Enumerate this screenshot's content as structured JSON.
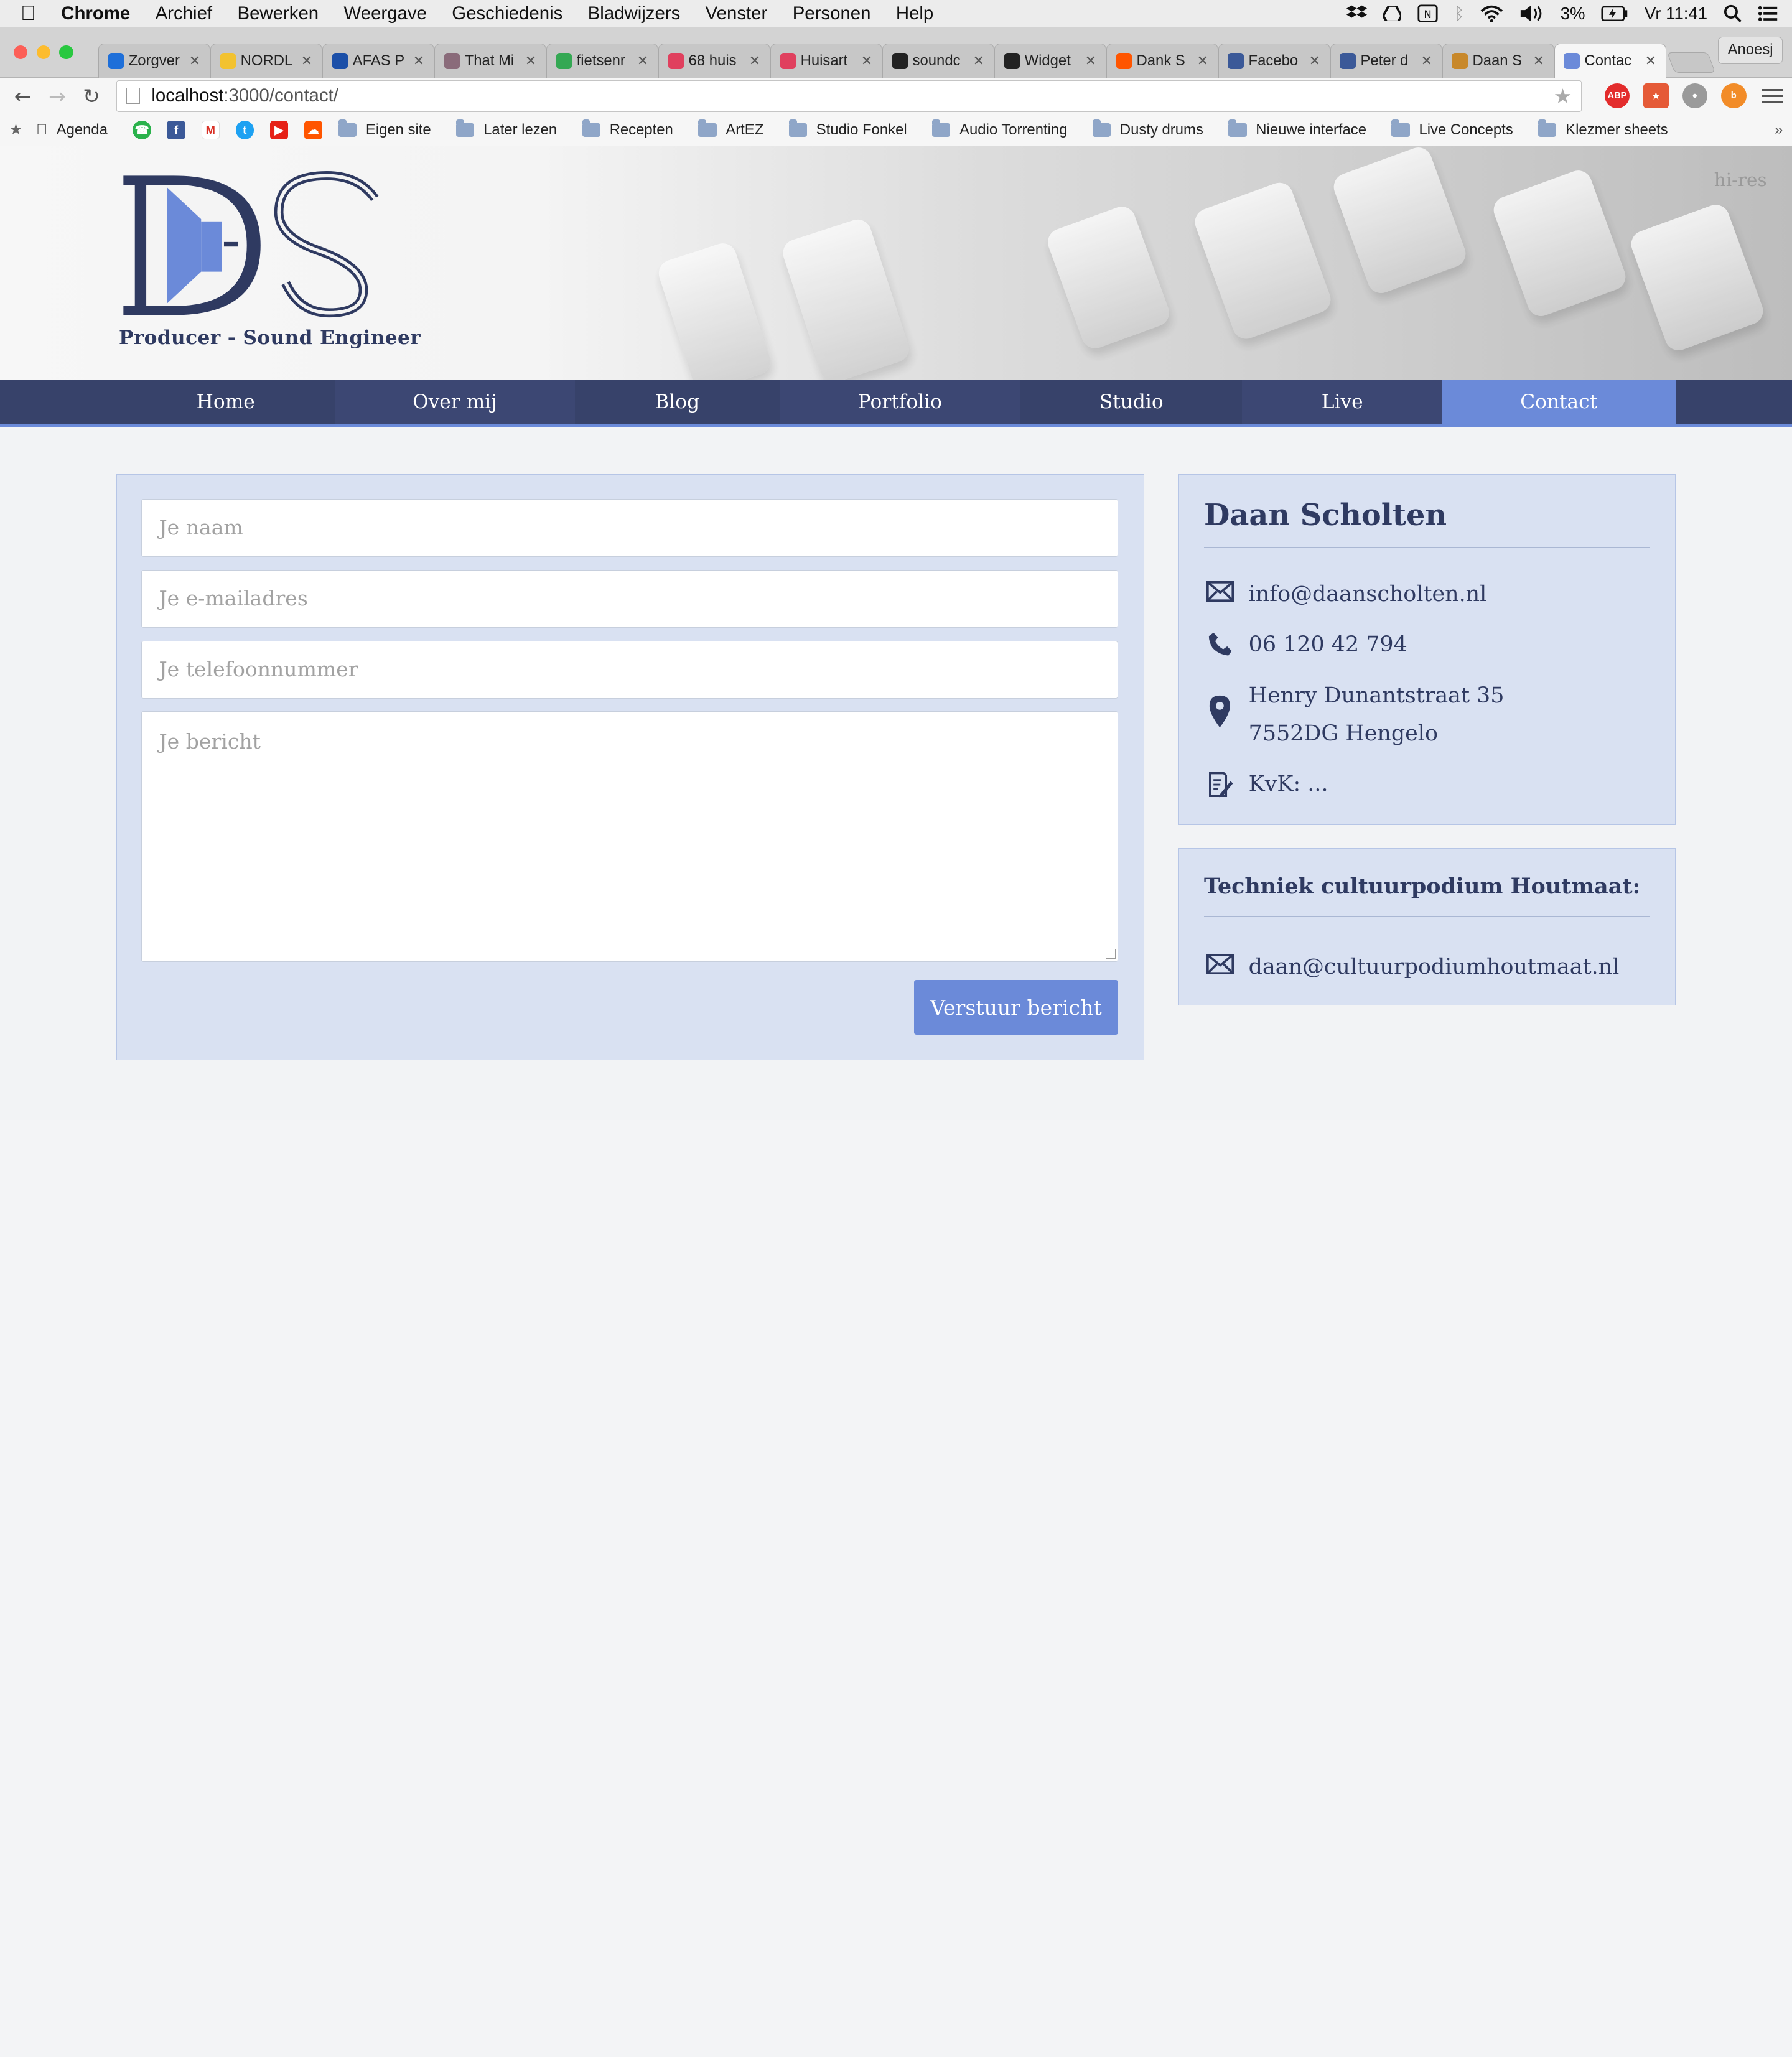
{
  "menubar": {
    "app": "Chrome",
    "items": [
      "Archief",
      "Bewerken",
      "Weergave",
      "Geschiedenis",
      "Bladwijzers",
      "Venster",
      "Personen",
      "Help"
    ],
    "battery": "3%",
    "clock": "Vr 11:41"
  },
  "tabs": [
    {
      "title": "Zorgver",
      "color": "#1e6fd9"
    },
    {
      "title": "NORDL",
      "color": "#f2c230"
    },
    {
      "title": "AFAS P",
      "color": "#1b4fa8"
    },
    {
      "title": "That Mi",
      "color": "#8a6b7a"
    },
    {
      "title": "fietsenr",
      "color": "#34a853"
    },
    {
      "title": "68 huis",
      "color": "#e0405e"
    },
    {
      "title": "Huisart",
      "color": "#e0405e"
    },
    {
      "title": "soundc",
      "color": "#222222"
    },
    {
      "title": "Widget",
      "color": "#222222"
    },
    {
      "title": "Dank S",
      "color": "#ff5500"
    },
    {
      "title": "Facebo",
      "color": "#3b5998"
    },
    {
      "title": "Peter d",
      "color": "#3b5998"
    },
    {
      "title": "Daan S",
      "color": "#c8882a"
    },
    {
      "title": "Contac",
      "color": "#6b8ad9"
    }
  ],
  "profile": "Anoesj",
  "address": {
    "host": "localhost",
    "path": ":3000/contact/"
  },
  "bookmarks": {
    "first": "Agenda",
    "folders": [
      "Eigen site",
      "Later lezen",
      "Recepten",
      "ArtEZ",
      "Studio Fonkel",
      "Audio Torrenting",
      "Dusty drums",
      "Nieuwe interface",
      "Live Concepts",
      "Klezmer sheets"
    ],
    "more": "»"
  },
  "site": {
    "tagline": "Producer - Sound Engineer",
    "hires": "hi-res",
    "nav": [
      "Home",
      "Over mij",
      "Blog",
      "Portfolio",
      "Studio",
      "Live",
      "Contact"
    ],
    "active_nav": "Contact"
  },
  "form": {
    "name_placeholder": "Je naam",
    "email_placeholder": "Je e-mailadres",
    "phone_placeholder": "Je telefoonnummer",
    "message_placeholder": "Je bericht",
    "submit": "Verstuur bericht"
  },
  "contact": {
    "name": "Daan Scholten",
    "email": "info@daanscholten.nl",
    "phone": "06 120 42 794",
    "address_line1": "Henry Dunantstraat 35",
    "address_line2": "7552DG Hengelo",
    "kvk": "KvK: ..."
  },
  "venue": {
    "title": "Techniek cultuurpodium Houtmaat:",
    "email": "daan@cultuurpodiumhoutmaat.nl"
  },
  "colors": {
    "navy": "#37426a",
    "accent": "#6b8ad9",
    "panel": "#d9e1f2"
  }
}
